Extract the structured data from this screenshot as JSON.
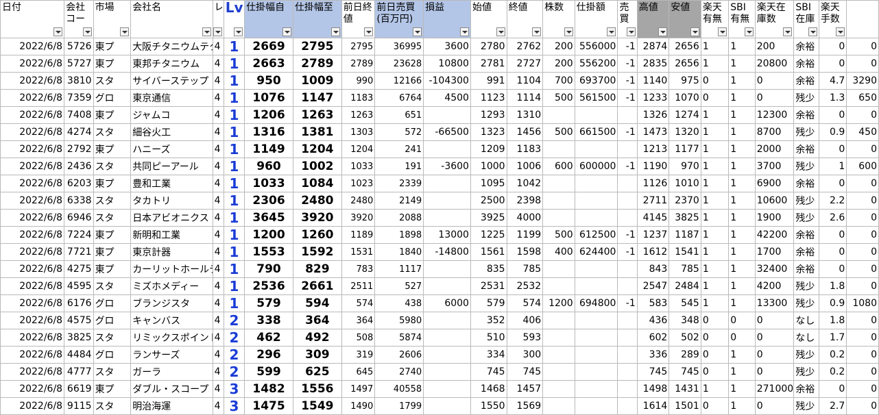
{
  "headers": [
    {
      "key": "date",
      "label": "日付"
    },
    {
      "key": "code",
      "label": "会社コード"
    },
    {
      "key": "market",
      "label": "市場"
    },
    {
      "key": "name",
      "label": "会社名"
    },
    {
      "key": "le",
      "label": "レ"
    },
    {
      "key": "lv",
      "label": "Lv"
    },
    {
      "key": "from",
      "label": "仕掛幅自"
    },
    {
      "key": "to",
      "label": "仕掛幅至"
    },
    {
      "key": "prevclose",
      "label": "前日終値"
    },
    {
      "key": "prevval",
      "label": "前日売買(百万円)"
    },
    {
      "key": "pl",
      "label": "損益"
    },
    {
      "key": "open",
      "label": "始値"
    },
    {
      "key": "close",
      "label": "終値"
    },
    {
      "key": "shares",
      "label": "株数"
    },
    {
      "key": "amount",
      "label": "仕掛額"
    },
    {
      "key": "side",
      "label": "売買"
    },
    {
      "key": "high",
      "label": "高値"
    },
    {
      "key": "low",
      "label": "安値"
    },
    {
      "key": "rakuten",
      "label": "楽天有無"
    },
    {
      "key": "sbi",
      "label": "SBI有無"
    },
    {
      "key": "rstock",
      "label": "楽天在庫数"
    },
    {
      "key": "sbistock",
      "label": "SBI在庫数"
    },
    {
      "key": "fee",
      "label": "楽天手数料"
    },
    {
      "key": "fee2",
      "label": ""
    }
  ],
  "rows": [
    [
      "2022/6/8",
      "5726",
      "東プ",
      "大阪チタニウムテク",
      "4",
      "1",
      "2669",
      "2795",
      "2795",
      "36995",
      "3600",
      "2780",
      "2762",
      "200",
      "556000",
      "-1",
      "2874",
      "2656",
      "1",
      "1",
      "200",
      "余裕",
      "0",
      "0"
    ],
    [
      "2022/6/8",
      "5727",
      "東プ",
      "東邦チタニウム",
      "4",
      "1",
      "2663",
      "2789",
      "2789",
      "23628",
      "10800",
      "2781",
      "2727",
      "200",
      "556200",
      "-1",
      "2835",
      "2656",
      "1",
      "1",
      "20800",
      "余裕",
      "0",
      "0"
    ],
    [
      "2022/6/8",
      "3810",
      "スタ",
      "サイバーステップ",
      "4",
      "1",
      "950",
      "1009",
      "990",
      "12166",
      "-104300",
      "991",
      "1104",
      "700",
      "693700",
      "-1",
      "1140",
      "975",
      "0",
      "1",
      "0",
      "余裕",
      "4.7",
      "3290"
    ],
    [
      "2022/6/8",
      "7359",
      "グロ",
      "東京通信",
      "4",
      "1",
      "1076",
      "1147",
      "1183",
      "6764",
      "4500",
      "1123",
      "1114",
      "500",
      "561500",
      "-1",
      "1233",
      "1070",
      "0",
      "1",
      "0",
      "残少",
      "1.3",
      "650"
    ],
    [
      "2022/6/8",
      "7408",
      "東プ",
      "ジャムコ",
      "4",
      "1",
      "1206",
      "1263",
      "1263",
      "651",
      "",
      "1293",
      "1310",
      "",
      "",
      "",
      "1326",
      "1274",
      "1",
      "1",
      "12300",
      "余裕",
      "0",
      "0"
    ],
    [
      "2022/6/8",
      "4274",
      "スタ",
      "細谷火工",
      "4",
      "1",
      "1316",
      "1381",
      "1303",
      "572",
      "-66500",
      "1323",
      "1456",
      "500",
      "661500",
      "-1",
      "1473",
      "1320",
      "1",
      "1",
      "8700",
      "残少",
      "0.9",
      "450"
    ],
    [
      "2022/6/8",
      "2792",
      "東プ",
      "ハニーズ",
      "4",
      "1",
      "1149",
      "1204",
      "1204",
      "241",
      "",
      "1209",
      "1183",
      "",
      "",
      "",
      "1213",
      "1177",
      "1",
      "1",
      "2000",
      "余裕",
      "0",
      "0"
    ],
    [
      "2022/6/8",
      "2436",
      "スタ",
      "共同ピーアール",
      "4",
      "1",
      "960",
      "1002",
      "1033",
      "191",
      "-3600",
      "1000",
      "1006",
      "600",
      "600000",
      "-1",
      "1190",
      "970",
      "1",
      "1",
      "3700",
      "残少",
      "1",
      "600"
    ],
    [
      "2022/6/8",
      "6203",
      "東プ",
      "豊和工業",
      "4",
      "1",
      "1033",
      "1084",
      "1023",
      "2339",
      "",
      "1095",
      "1042",
      "",
      "",
      "",
      "1126",
      "1010",
      "1",
      "1",
      "6900",
      "余裕",
      "0",
      "0"
    ],
    [
      "2022/6/8",
      "6338",
      "スタ",
      "タカトリ",
      "4",
      "1",
      "2306",
      "2480",
      "2480",
      "2149",
      "",
      "2500",
      "2398",
      "",
      "",
      "",
      "2711",
      "2370",
      "1",
      "1",
      "10600",
      "残少",
      "2.2",
      "0"
    ],
    [
      "2022/6/8",
      "6946",
      "スタ",
      "日本アビオニクス",
      "4",
      "1",
      "3645",
      "3920",
      "3920",
      "2088",
      "",
      "3925",
      "4000",
      "",
      "",
      "",
      "4145",
      "3825",
      "1",
      "1",
      "1900",
      "残少",
      "2.6",
      "0"
    ],
    [
      "2022/6/8",
      "7224",
      "東プ",
      "新明和工業",
      "4",
      "1",
      "1200",
      "1260",
      "1189",
      "1898",
      "13000",
      "1225",
      "1199",
      "500",
      "612500",
      "-1",
      "1237",
      "1187",
      "1",
      "1",
      "42200",
      "余裕",
      "0",
      "0"
    ],
    [
      "2022/6/8",
      "7721",
      "東プ",
      "東京計器",
      "4",
      "1",
      "1553",
      "1592",
      "1531",
      "1840",
      "-14800",
      "1561",
      "1598",
      "400",
      "624400",
      "-1",
      "1612",
      "1541",
      "1",
      "1",
      "1700",
      "余裕",
      "0",
      "0"
    ],
    [
      "2022/6/8",
      "4275",
      "東プ",
      "カーリットホールデ",
      "4",
      "1",
      "790",
      "829",
      "783",
      "1117",
      "",
      "835",
      "785",
      "",
      "",
      "",
      "843",
      "785",
      "1",
      "1",
      "32400",
      "余裕",
      "0",
      "0"
    ],
    [
      "2022/6/8",
      "4595",
      "スタ",
      "ミズホメディー",
      "4",
      "1",
      "2536",
      "2661",
      "2511",
      "527",
      "",
      "2531",
      "2532",
      "",
      "",
      "",
      "2547",
      "2484",
      "1",
      "1",
      "4200",
      "残少",
      "1.8",
      "0"
    ],
    [
      "2022/6/8",
      "6176",
      "グロ",
      "ブランジスタ",
      "4",
      "1",
      "579",
      "594",
      "574",
      "438",
      "6000",
      "579",
      "574",
      "1200",
      "694800",
      "-1",
      "583",
      "545",
      "1",
      "1",
      "13300",
      "残少",
      "0.9",
      "1080"
    ],
    [
      "2022/6/8",
      "4575",
      "グロ",
      "キャンバス",
      "4",
      "2",
      "338",
      "364",
      "364",
      "5980",
      "",
      "352",
      "406",
      "",
      "",
      "",
      "436",
      "348",
      "0",
      "0",
      "0",
      "なし",
      "1.8",
      "0"
    ],
    [
      "2022/6/8",
      "3825",
      "スタ",
      "リミックスポイント",
      "4",
      "2",
      "462",
      "492",
      "508",
      "5874",
      "",
      "510",
      "593",
      "",
      "",
      "",
      "602",
      "502",
      "0",
      "0",
      "0",
      "なし",
      "1.7",
      "0"
    ],
    [
      "2022/6/8",
      "4484",
      "グロ",
      "ランサーズ",
      "4",
      "2",
      "296",
      "309",
      "319",
      "2606",
      "",
      "334",
      "300",
      "",
      "",
      "",
      "336",
      "289",
      "0",
      "1",
      "0",
      "残少",
      "0.2",
      "0"
    ],
    [
      "2022/6/8",
      "4777",
      "スタ",
      "ガーラ",
      "4",
      "2",
      "599",
      "625",
      "645",
      "2740",
      "",
      "745",
      "745",
      "",
      "",
      "",
      "745",
      "745",
      "0",
      "1",
      "0",
      "残少",
      "0.2",
      "0"
    ],
    [
      "2022/6/8",
      "6619",
      "東プ",
      "ダブル・スコープ",
      "4",
      "3",
      "1482",
      "1556",
      "1497",
      "40558",
      "",
      "1468",
      "1457",
      "",
      "",
      "",
      "1498",
      "1431",
      "1",
      "1",
      "271000",
      "余裕",
      "0",
      "0"
    ],
    [
      "2022/6/8",
      "9115",
      "スタ",
      "明治海運",
      "4",
      "3",
      "1475",
      "1549",
      "1490",
      "1799",
      "",
      "1550",
      "1569",
      "",
      "",
      "",
      "1614",
      "1501",
      "0",
      "1",
      "0",
      "残少",
      "2.7",
      "0"
    ]
  ]
}
